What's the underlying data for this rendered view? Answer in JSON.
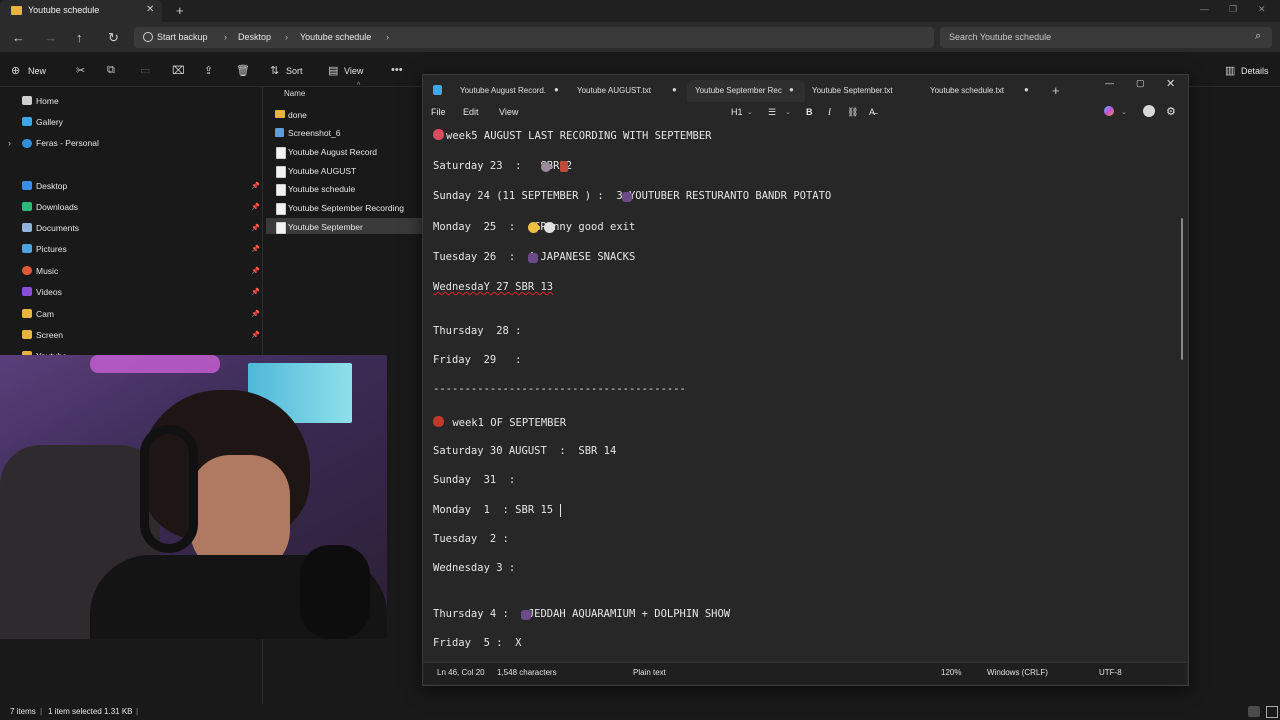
{
  "explorer": {
    "window_title": "Youtube schedule",
    "breadcrumbs": [
      "Start backup",
      "Desktop",
      "Youtube schedule"
    ],
    "search_placeholder": "Search Youtube schedule",
    "commands": {
      "new": "New",
      "sort": "Sort",
      "view": "View",
      "details": "Details"
    },
    "sidebar": {
      "top": [
        "Home",
        "Gallery",
        "Feras - Personal"
      ],
      "quick": [
        "Desktop",
        "Downloads",
        "Documents",
        "Pictures",
        "Music",
        "Videos",
        "Cam",
        "Screen",
        "Youtube"
      ]
    },
    "column_header": "Name",
    "files": [
      "done",
      "Screenshot_6",
      "Youtube August Record",
      "Youtube AUGUST",
      "Youtube schedule",
      "Youtube September Recording",
      "Youtube September"
    ],
    "status": {
      "count": "7 items",
      "selection": "1 item selected  1.31 KB"
    }
  },
  "notepad": {
    "tabs": [
      "Youtube August Record.",
      "Youtube AUGUST.txt",
      "Youtube September Rec",
      "Youtube September.txt",
      "Youtube schedule.txt"
    ],
    "menu": [
      "File",
      "Edit",
      "View"
    ],
    "heading": "H1",
    "lines": [
      "week5 AUGUST LAST RECORDING WITH SEPTEMBER",
      "Saturday 23  :   SBR12",
      "Sunday 24 (11 SEPTEMBER ) :  3 YOUTUBER RESTURANTO BANDR POTATO",
      "Monday  25  :   GRanny good exit",
      "Tuesday 26  :  4 JAPANESE SNACKS",
      "WednesdaY 27 SBR 13",
      "Thursday  28 :",
      "Friday  29   :",
      "----------------------------------------",
      " week1 OF SEPTEMBER",
      "Saturday 30 AUGUST  :  SBR 14",
      "Sunday  31  :",
      "Monday  1  : SBR 15",
      "Tuesday  2 :",
      "Wednesday 3 :",
      "Thursday 4 :   JEDDAH AQUARAMIUM + DOLPHIN SHOW",
      "Friday  5 :  X"
    ],
    "status": {
      "position": "Ln 46, Col 20",
      "chars": "1,548 characters",
      "type": "Plain text",
      "zoom": "120%",
      "eol": "Windows (CRLF)",
      "encoding": "UTF-8"
    }
  },
  "colors": {
    "accent": "#4cc2ff",
    "folder": "#e8b43f",
    "emoji_red": "#d94c5c",
    "emoji_purple": "#6b4a8a"
  }
}
